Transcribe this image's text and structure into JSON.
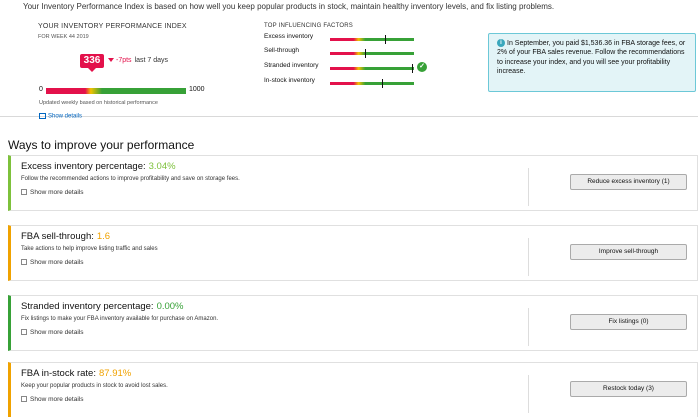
{
  "intro": "Your Inventory Performance Index is based on how well you keep popular products in stock, maintain healthy inventory levels, and fix listing problems.",
  "index": {
    "title": "YOUR INVENTORY PERFORMANCE INDEX",
    "week": "FOR WEEK 44 2019",
    "score": "336",
    "delta": "-7pts",
    "delta_period": "last 7 days",
    "scale_min": "0",
    "scale_max": "1000",
    "score_value": 336,
    "updated_note": "Updated weekly based on historical performance",
    "show_details": "Show details"
  },
  "factors": {
    "title": "TOP INFLUENCING FACTORS",
    "items": [
      {
        "label": "Excess inventory",
        "position": 0.65,
        "ok": false
      },
      {
        "label": "Sell-through",
        "position": 0.42,
        "ok": false
      },
      {
        "label": "Stranded inventory",
        "position": 0.98,
        "ok": true
      },
      {
        "label": "In-stock inventory",
        "position": 0.62,
        "ok": false
      }
    ]
  },
  "info_box": {
    "text": "In September, you paid $1,536.36 in FBA storage fees, or 2% of your FBA sales revenue. Follow the recommendations to increase your index, and you will see your profitability increase."
  },
  "ways": {
    "title": "Ways to improve your performance",
    "show_more": "Show more details",
    "cards": [
      {
        "title": "Excess inventory percentage:",
        "value": "3.04%",
        "value_color": "#7dc13b",
        "border_color": "#7dc13b",
        "desc": "Follow the recommended actions to improve profitability and save on storage fees.",
        "button": "Reduce excess inventory (1)"
      },
      {
        "title": "FBA sell-through:",
        "value": "1.6",
        "value_color": "#f0a200",
        "border_color": "#f0a200",
        "desc": "Take actions to help improve listing traffic and sales",
        "button": "Improve sell-through"
      },
      {
        "title": "Stranded inventory percentage:",
        "value": "0.00%",
        "value_color": "#37a137",
        "border_color": "#37a137",
        "desc": "Fix listings to make your FBA inventory available for purchase on Amazon.",
        "button": "Fix listings (0)"
      },
      {
        "title": "FBA in-stock rate:",
        "value": "87.91%",
        "value_color": "#f0a200",
        "border_color": "#f0a200",
        "desc": "Keep your popular products in stock to avoid lost sales.",
        "button": "Restock today (3)"
      }
    ]
  }
}
